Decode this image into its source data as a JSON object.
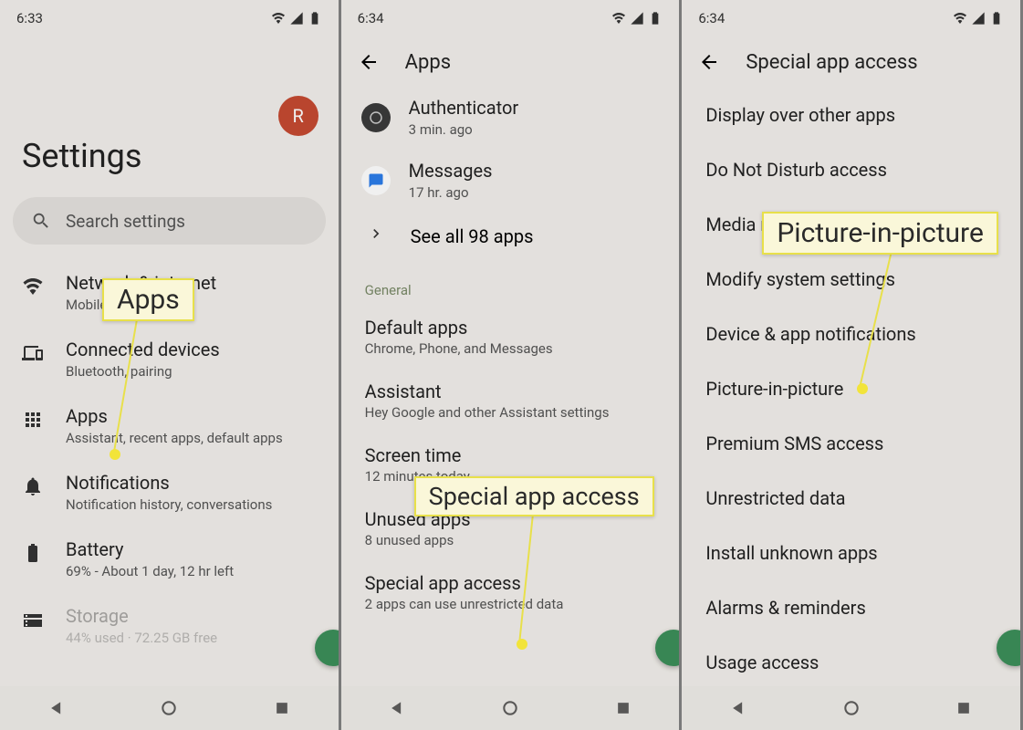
{
  "panel1": {
    "time": "6:33",
    "title": "Settings",
    "avatar_initial": "R",
    "search_placeholder": "Search settings",
    "items": [
      {
        "icon": "wifi",
        "title": "Network & internet",
        "sub": "Mobile"
      },
      {
        "icon": "devices",
        "title": "Connected devices",
        "sub": "Bluetooth, pairing"
      },
      {
        "icon": "apps",
        "title": "Apps",
        "sub": "Assistant, recent apps, default apps"
      },
      {
        "icon": "bell",
        "title": "Notifications",
        "sub": "Notification history, conversations"
      },
      {
        "icon": "battery",
        "title": "Battery",
        "sub": "69% - About 1 day, 12 hr left"
      },
      {
        "icon": "storage",
        "title": "Storage",
        "sub": "44% used · 72.25 GB free"
      }
    ],
    "callout": "Apps"
  },
  "panel2": {
    "time": "6:34",
    "title": "Apps",
    "recent": [
      {
        "icon": "auth",
        "title": "Authenticator",
        "sub": "3 min. ago"
      },
      {
        "icon": "msg",
        "title": "Messages",
        "sub": "17 hr. ago"
      }
    ],
    "see_all": "See all 98 apps",
    "section": "General",
    "rows": [
      {
        "title": "Default apps",
        "sub": "Chrome, Phone, and Messages"
      },
      {
        "title": "Assistant",
        "sub": "Hey Google and other Assistant settings"
      },
      {
        "title": "Screen time",
        "sub": "12 minutes today"
      },
      {
        "title": "Unused apps",
        "sub": "8 unused apps"
      },
      {
        "title": "Special app access",
        "sub": "2 apps can use unrestricted data"
      }
    ],
    "callout": "Special app access"
  },
  "panel3": {
    "time": "6:34",
    "title": "Special app access",
    "rows": [
      "Display over other apps",
      "Do Not Disturb access",
      "Media management apps",
      "Modify system settings",
      "Device & app notifications",
      "Picture-in-picture",
      "Premium SMS access",
      "Unrestricted data",
      "Install unknown apps",
      "Alarms & reminders",
      "Usage access"
    ],
    "callout": "Picture-in-picture"
  }
}
